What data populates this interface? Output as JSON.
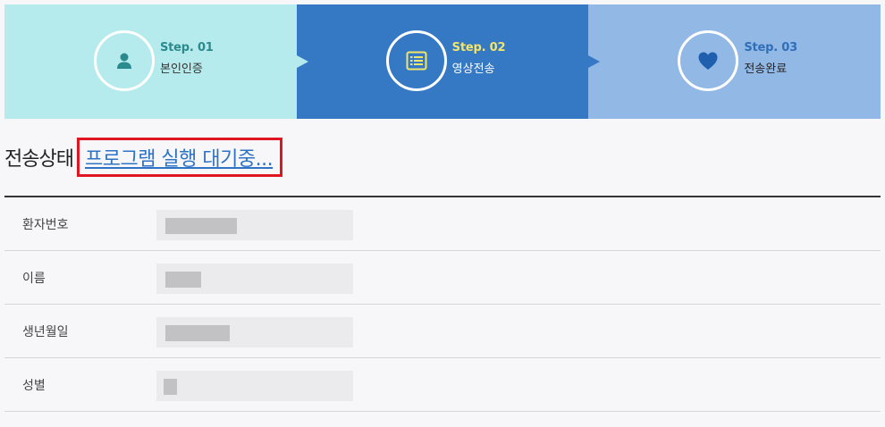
{
  "steps": [
    {
      "num": "Step. 01",
      "label": "본인인증",
      "icon": "person-icon"
    },
    {
      "num": "Step. 02",
      "label": "영상전송",
      "icon": "list-document-icon"
    },
    {
      "num": "Step. 03",
      "label": "전송완료",
      "icon": "heart-icon"
    }
  ],
  "colors": {
    "step1_bg": "#b5ebec",
    "step2_bg": "#3578c4",
    "step3_bg": "#92b8e5",
    "status_link": "#2f73c4",
    "highlight_border": "#e01522"
  },
  "status": {
    "title": "전송상태",
    "value": "프로그램 실행 대기중..."
  },
  "fields": [
    {
      "label": "환자번호"
    },
    {
      "label": "이름"
    },
    {
      "label": "생년월일"
    },
    {
      "label": "성별"
    }
  ]
}
